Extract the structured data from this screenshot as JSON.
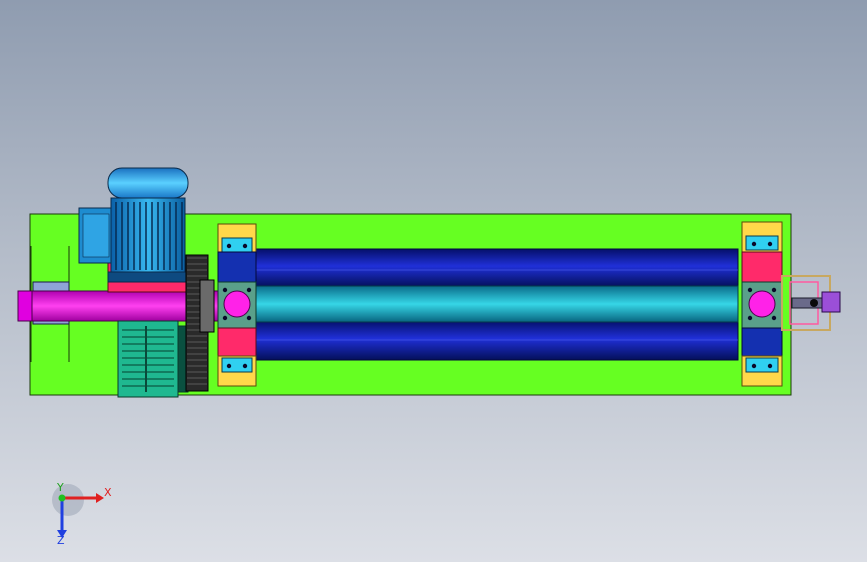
{
  "viewport": {
    "background_top": "#8f9cb0",
    "background_bottom": "#dcdfe6"
  },
  "model": {
    "parts": [
      {
        "name": "base-plate",
        "color": "#66ff22"
      },
      {
        "name": "electric-motor",
        "color": "#1fa8e8"
      },
      {
        "name": "motor-terminal-box",
        "color": "#1e8cd0"
      },
      {
        "name": "reducer-gearbox",
        "color": "#1fb890"
      },
      {
        "name": "drive-shaft",
        "color": "#ff22e8"
      },
      {
        "name": "upper-roller",
        "color": "#0a1fb0"
      },
      {
        "name": "middle-roller",
        "color": "#22c8d8"
      },
      {
        "name": "lower-roller",
        "color": "#0a1fb0"
      },
      {
        "name": "bearing-block-left",
        "color": "#ff2a6a"
      },
      {
        "name": "bearing-block-right",
        "color": "#ff2a6a"
      },
      {
        "name": "drive-gear",
        "color": "#333333"
      },
      {
        "name": "adjuster-mechanism",
        "color": "#9b4fd8"
      }
    ]
  },
  "triad": {
    "x_label": "X",
    "y_label": "Y",
    "z_label": "Z",
    "x_color": "#e02020",
    "y_color": "#20c020",
    "z_color": "#2040e0"
  }
}
